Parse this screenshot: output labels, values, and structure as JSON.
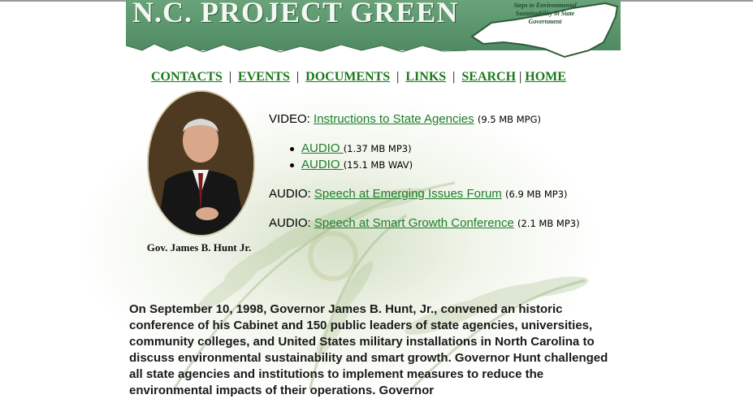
{
  "banner": {
    "title": "N.C. PROJECT GREEN",
    "map_text": "Steps to Environmental Sustainability in State Government"
  },
  "nav": {
    "items": [
      {
        "label": "CONTACTS"
      },
      {
        "label": "EVENTS"
      },
      {
        "label": "DOCUMENTS"
      },
      {
        "label": "LINKS"
      },
      {
        "label": "SEARCH"
      },
      {
        "label": "HOME"
      }
    ],
    "separator": "|"
  },
  "portrait": {
    "caption": "Gov. James B. Hunt Jr."
  },
  "media": {
    "video": {
      "prefix": "VIDEO:",
      "link": "Instructions to State Agencies",
      "size": "(9.5 MB MPG)"
    },
    "audio_items": [
      {
        "link": "AUDIO ",
        "size": "(1.37 MB MP3)"
      },
      {
        "link": "AUDIO ",
        "size": "(15.1 MB WAV)"
      }
    ],
    "audio1": {
      "prefix": "AUDIO:",
      "link": "Speech at Emerging Issues Forum",
      "size": "(6.9 MB MP3)"
    },
    "audio2": {
      "prefix": "AUDIO:",
      "link": "Speech at Smart Growth Conference",
      "size": "(2.1 MB MP3)"
    }
  },
  "body": {
    "text": "On September 10, 1998, Governor James B. Hunt, Jr., convened an historic conference of his Cabinet and 150 public leaders of state agencies, universities, community colleges, and United States military installations in North Carolina to discuss environmental sustainability and smart growth. Governor Hunt challenged all state agencies and institutions to implement measures to reduce the environmental impacts of their operations. Governor"
  },
  "colors": {
    "banner_green": "#5b956c",
    "link_green": "#1e7d2b",
    "nav_green": "#1c7a1c"
  }
}
